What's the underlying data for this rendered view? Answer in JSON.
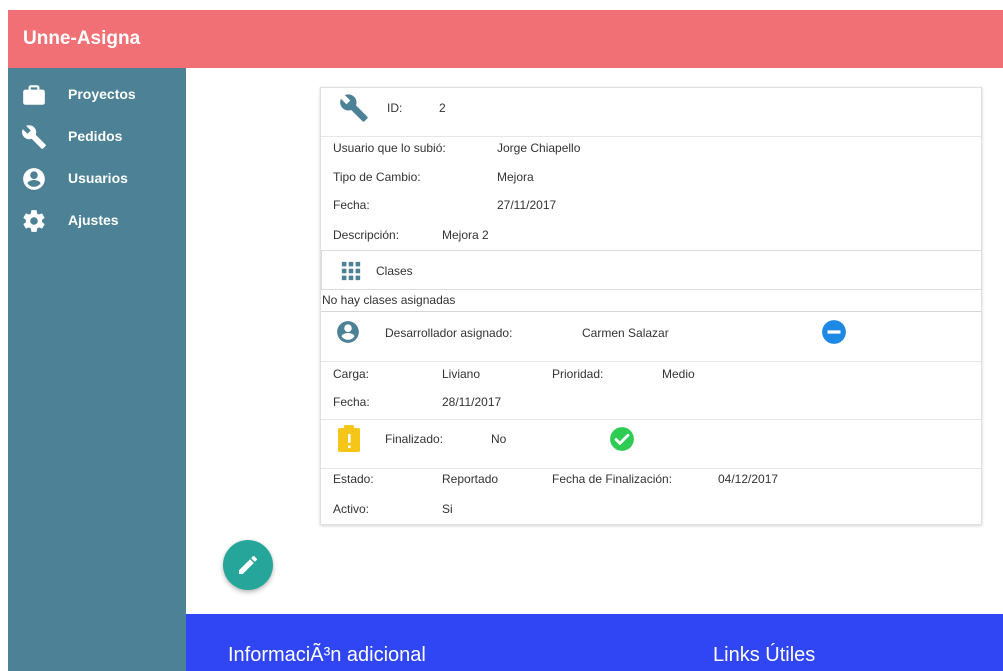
{
  "app": {
    "title": "Unne-Asigna"
  },
  "sidebar": {
    "items": [
      {
        "label": "Proyectos",
        "icon": "briefcase-icon"
      },
      {
        "label": "Pedidos",
        "icon": "wrench-icon"
      },
      {
        "label": "Usuarios",
        "icon": "account-circle-icon"
      },
      {
        "label": "Ajustes",
        "icon": "gear-icon"
      }
    ]
  },
  "pedido": {
    "id_label": "ID:",
    "id_value": "2",
    "usuario_label": "Usuario que lo subió:",
    "usuario_value": "Jorge Chiapello",
    "tipo_label": "Tipo de Cambio:",
    "tipo_value": "Mejora",
    "fecha_label": "Fecha:",
    "fecha_value": "27/11/2017",
    "descripcion_label": "Descripción:",
    "descripcion_value": "Mejora 2"
  },
  "clases": {
    "header": "Clases",
    "empty_text": "No hay clases asignadas"
  },
  "asignacion": {
    "dev_label": "Desarrollador asignado:",
    "dev_value": "Carmen Salazar",
    "carga_label": "Carga:",
    "carga_value": "Liviano",
    "prioridad_label": "Prioridad:",
    "prioridad_value": "Medio",
    "fecha_label": "Fecha:",
    "fecha_value": "28/11/2017"
  },
  "finalizado": {
    "label": "Finalizado:",
    "value": "No"
  },
  "estado": {
    "estado_label": "Estado:",
    "estado_value": "Reportado",
    "fecha_fin_label": "Fecha de Finalización:",
    "fecha_fin_value": "04/12/2017",
    "activo_label": "Activo:",
    "activo_value": "Si"
  },
  "footer": {
    "info_title": "InformaciÃ³n adicional",
    "links_title": "Links Útiles"
  },
  "colors": {
    "header": "#f07075",
    "sidebar": "#4c8196",
    "footer": "#3046f5",
    "fab": "#26a69a",
    "icon": "#4c8196",
    "remove_button": "#1e88e5",
    "check_button": "#2ecc52",
    "warning_icon": "#f5c518"
  }
}
